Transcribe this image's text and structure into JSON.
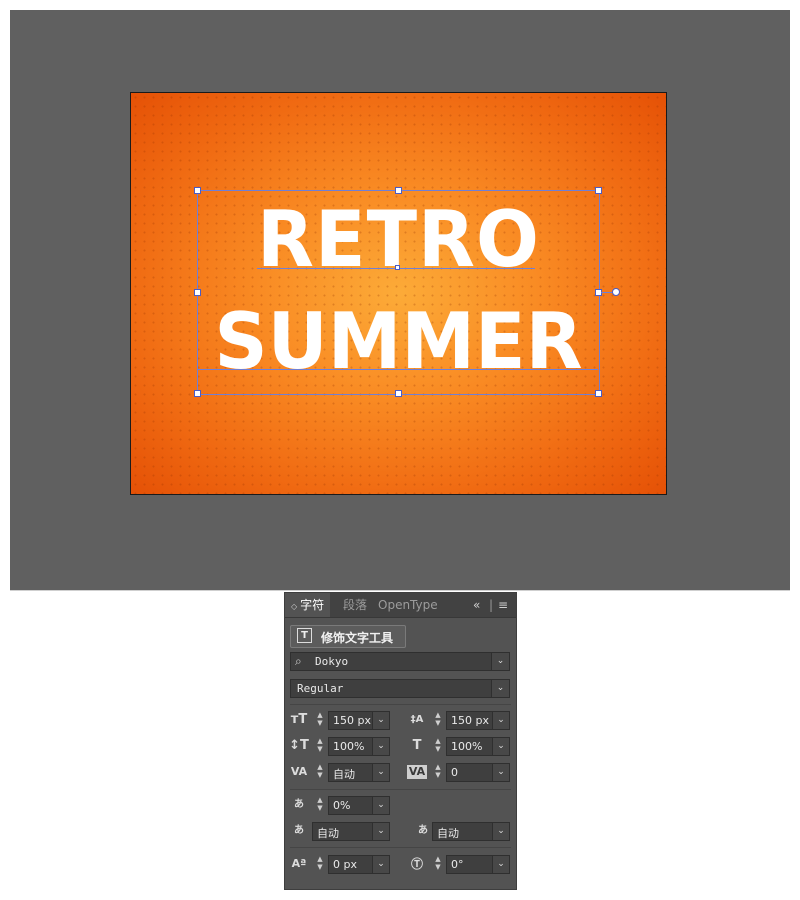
{
  "canvas": {
    "headline_line1": "RETRO",
    "headline_line2": "SUMMER",
    "accent_color": "#f98a23",
    "selection_color": "#6f7fd6"
  },
  "panel": {
    "tabs": [
      {
        "label": "字符",
        "active": true
      },
      {
        "label": "段落",
        "active": false
      },
      {
        "label": "OpenType",
        "active": false
      }
    ],
    "collapse_icon": "double-chevron-left-icon",
    "menu_icon": "hamburger-menu-icon",
    "touch_type_tool_label": "修饰文字工具",
    "font_family": "Dokyo",
    "font_style": "Regular",
    "font_size": "150 px",
    "leading": "150 px",
    "vertical_scale": "100%",
    "horizontal_scale": "100%",
    "kerning": "自动",
    "tracking": "0",
    "tsume": "0%",
    "aki_left": "自动",
    "aki_right": "自动",
    "baseline_shift": "0 px",
    "rotation": "0°"
  }
}
